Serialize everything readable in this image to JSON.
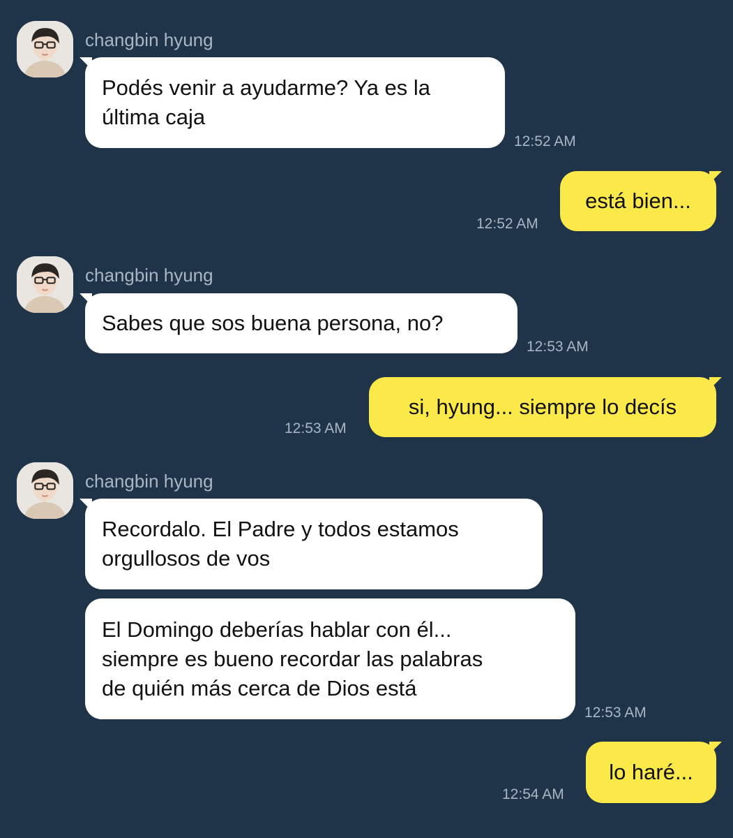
{
  "conversation": {
    "sender_name": "changbin hyung",
    "messages": [
      {
        "from": "changbin hyung",
        "text": "Podés venir a ayudarme? Ya es la\núltima caja",
        "time": "12:52 AM"
      },
      {
        "from": "me",
        "text": "está bien...",
        "time": "12:52 AM"
      },
      {
        "from": "changbin hyung",
        "text": "Sabes que sos buena persona, no?",
        "time": "12:53 AM"
      },
      {
        "from": "me",
        "text": "si, hyung... siempre lo decís",
        "time": "12:53 AM"
      },
      {
        "from": "changbin hyung",
        "text": "Recordalo. El Padre y todos estamos\norgullosos de vos",
        "time": ""
      },
      {
        "from": "changbin hyung",
        "text": "El Domingo deberías hablar con él...\nsiempre es bueno recordar las palabras\nde quién más cerca de Dios está",
        "time": "12:53 AM"
      },
      {
        "from": "me",
        "text": "lo haré...",
        "time": "12:54 AM"
      }
    ]
  },
  "colors": {
    "background": "#1f3449",
    "incoming_bubble": "#ffffff",
    "outgoing_bubble": "#fbe94a",
    "meta_text": "#a9b6c4"
  },
  "icons": {
    "avatar": "profile-photo"
  }
}
